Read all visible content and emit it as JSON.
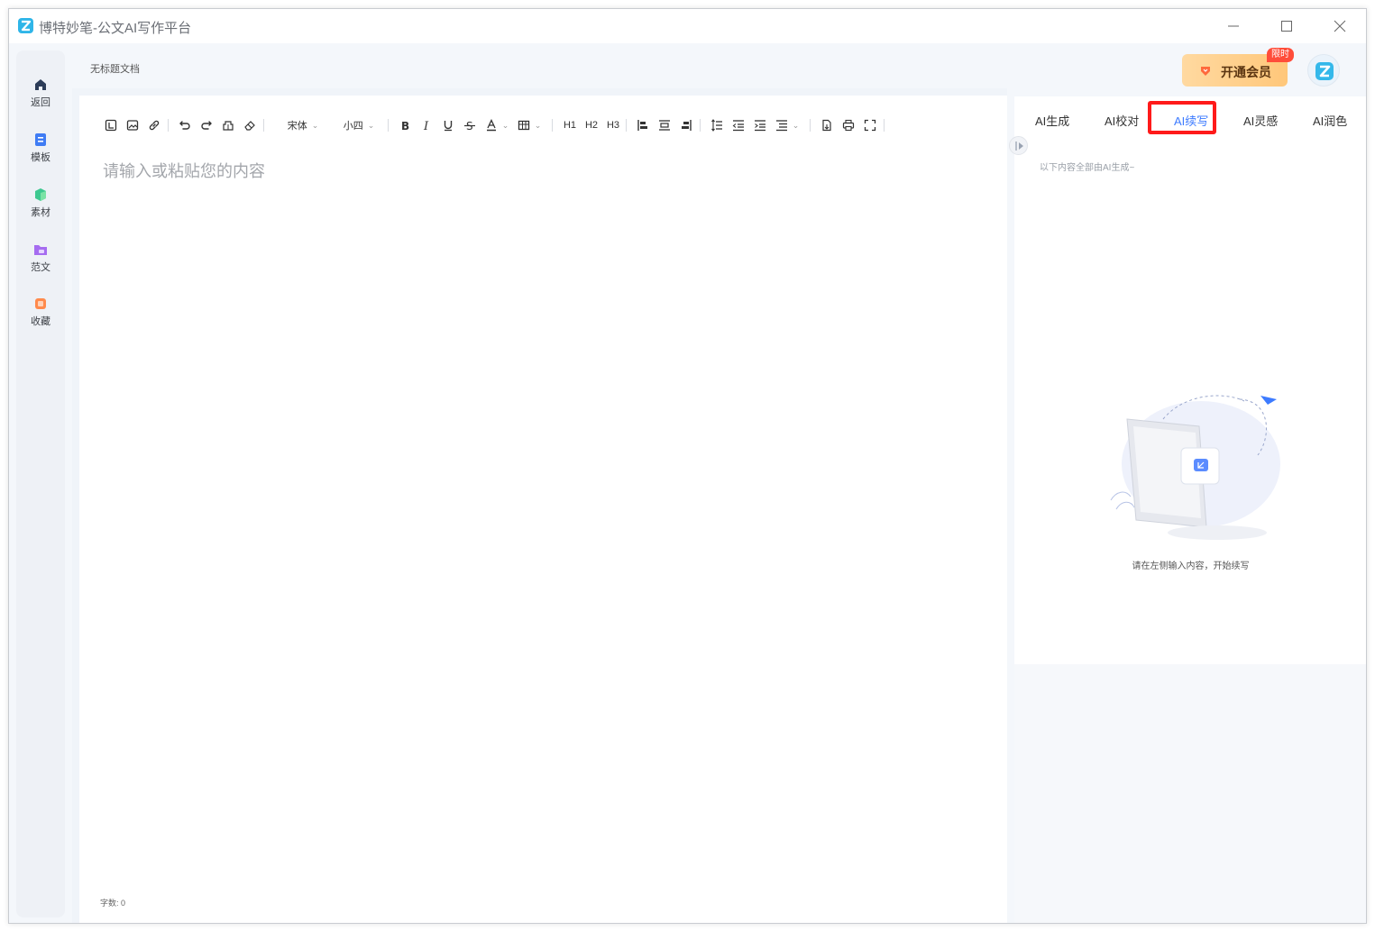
{
  "window": {
    "title": "博特妙笔-公文AI写作平台",
    "controls": {
      "minimize": "minimize",
      "maximize": "maximize",
      "close": "close"
    }
  },
  "sidebar": {
    "items": [
      {
        "label": "返回",
        "icon": "home-icon"
      },
      {
        "label": "模板",
        "icon": "template-icon"
      },
      {
        "label": "素材",
        "icon": "material-icon"
      },
      {
        "label": "范文",
        "icon": "sample-icon"
      },
      {
        "label": "收藏",
        "icon": "favorite-icon"
      }
    ]
  },
  "header": {
    "doc_title": "无标题文档",
    "vip_label": "开通会员",
    "vip_badge": "限时"
  },
  "toolbar": {
    "font_family": "宋体",
    "font_size": "小四",
    "h1": "H1",
    "h2": "H2",
    "h3": "H3",
    "icons": [
      "import-icon",
      "image-icon",
      "link-icon",
      "undo-icon",
      "redo-icon",
      "format-painter-icon",
      "eraser-icon",
      "bold-icon",
      "italic-icon",
      "underline-icon",
      "strikethrough-icon",
      "font-color-icon",
      "table-icon",
      "align-left-icon",
      "align-center-icon",
      "align-right-icon",
      "line-height-icon",
      "indent-decrease-icon",
      "indent-increase-icon",
      "list-icon",
      "export-icon",
      "print-icon",
      "fullscreen-icon"
    ]
  },
  "editor": {
    "placeholder": "请输入或粘贴您的内容",
    "word_count": "字数: 0"
  },
  "ai_panel": {
    "tabs": [
      {
        "label": "AI生成",
        "active": false
      },
      {
        "label": "AI校对",
        "active": false
      },
      {
        "label": "AI续写",
        "active": true
      },
      {
        "label": "AI灵感",
        "active": false
      },
      {
        "label": "AI润色",
        "active": false
      }
    ],
    "hint": "以下内容全部由AI生成~",
    "empty_text": "请在左侧输入内容，开始续写"
  },
  "colors": {
    "accent": "#3d7bff",
    "highlight": "#ff1a1a",
    "vip_gradient_start": "#ffd9a0",
    "vip_gradient_end": "#ffc77a",
    "badge": "#ff4d3a"
  }
}
